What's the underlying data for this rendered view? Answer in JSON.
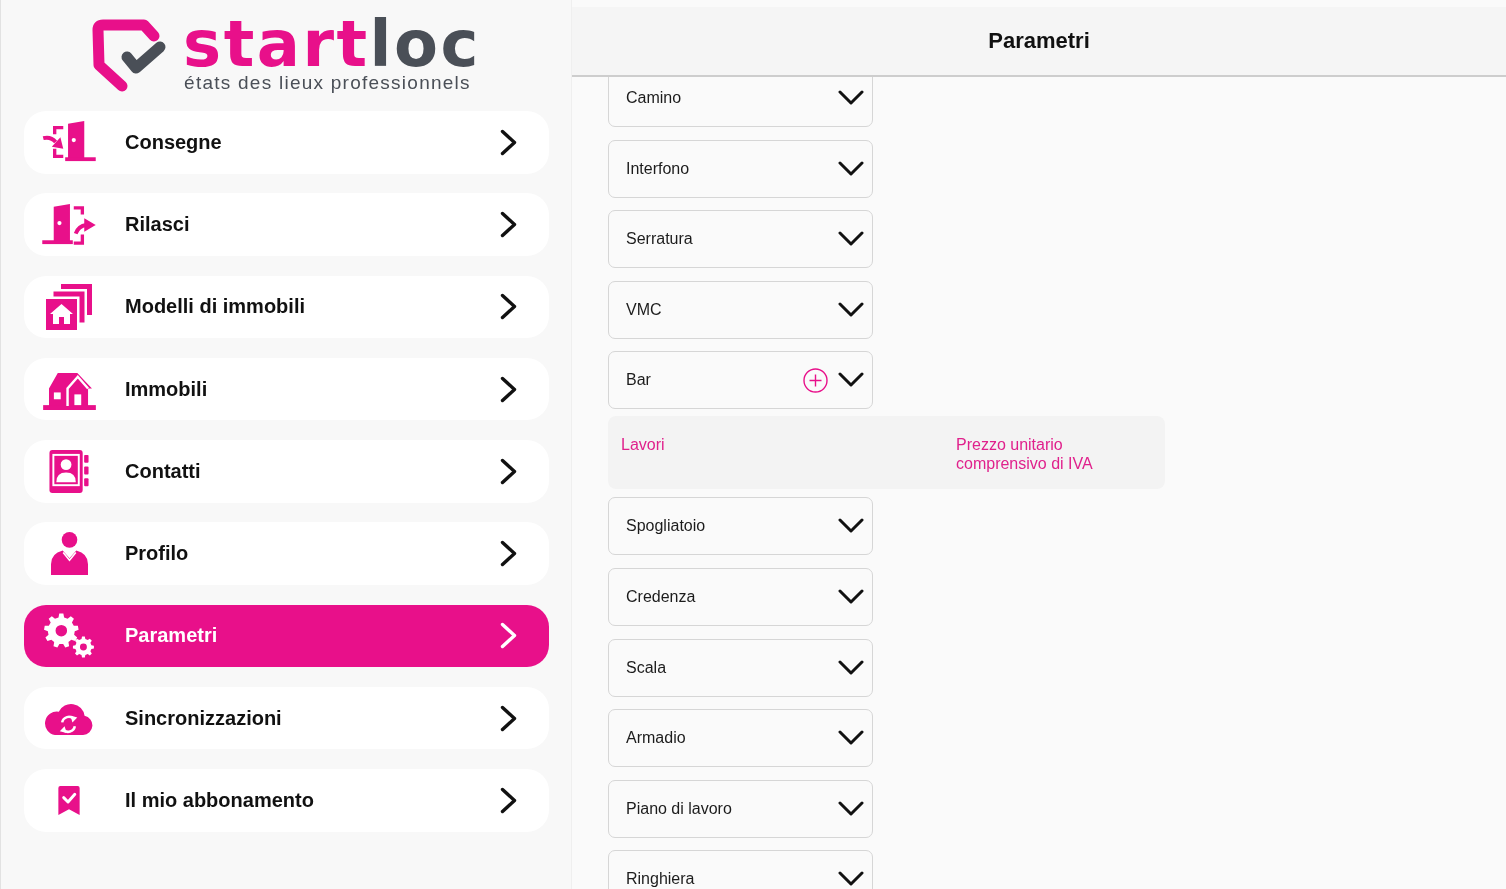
{
  "sidebar": {
    "logo": {
      "wordmark": [
        "start",
        "loc"
      ],
      "tagline": "états des lieux professionnels"
    },
    "items": [
      {
        "label": "Consegne",
        "selected": false
      },
      {
        "label": "Rilasci",
        "selected": false
      },
      {
        "label": "Modelli di immobili",
        "selected": false
      },
      {
        "label": "Immobili",
        "selected": false
      },
      {
        "label": "Contatti",
        "selected": false
      },
      {
        "label": "Profilo",
        "selected": false
      },
      {
        "label": "Parametri",
        "selected": true
      },
      {
        "label": "Sincronizzazioni",
        "selected": false
      },
      {
        "label": "Il mio abbonamento",
        "selected": false
      }
    ]
  },
  "header": {
    "title": "Parametri"
  },
  "categories": [
    {
      "label": "Camino",
      "expanded": false
    },
    {
      "label": "Interfono",
      "expanded": false
    },
    {
      "label": "Serratura",
      "expanded": false
    },
    {
      "label": "VMC",
      "expanded": false
    },
    {
      "label": "Bar",
      "expanded": true,
      "columns": [
        "Lavori",
        "Prezzo unitario comprensivo di IVA"
      ]
    },
    {
      "label": "Spogliatoio",
      "expanded": false
    },
    {
      "label": "Credenza",
      "expanded": false
    },
    {
      "label": "Scala",
      "expanded": false
    },
    {
      "label": "Armadio",
      "expanded": false
    },
    {
      "label": "Piano di lavoro",
      "expanded": false
    },
    {
      "label": "Ringhiera",
      "expanded": false
    }
  ]
}
